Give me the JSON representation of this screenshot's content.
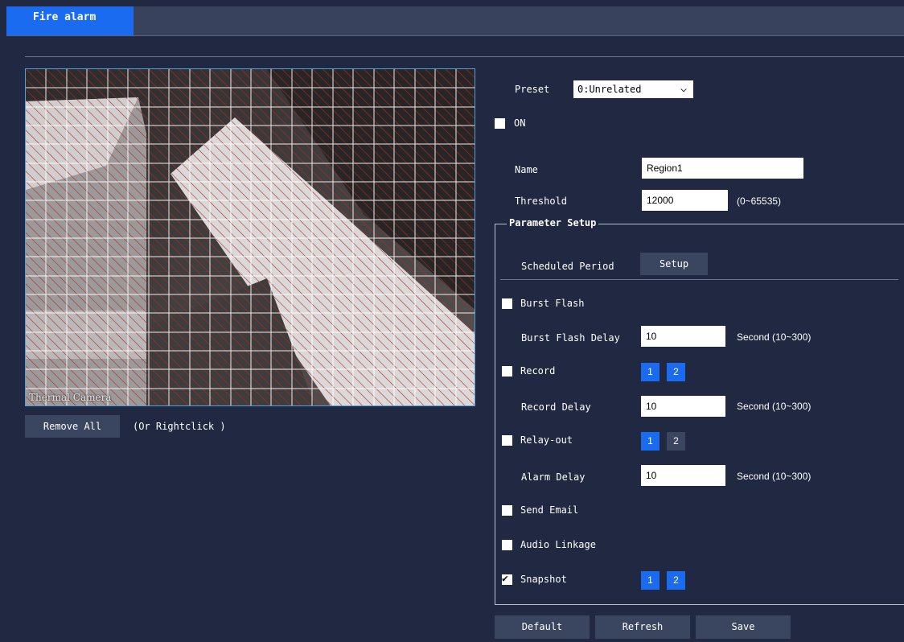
{
  "tabs": {
    "active_label": "Fire alarm"
  },
  "video": {
    "camera_label": "Thermal Camera"
  },
  "region_controls": {
    "remove_all_label": "Remove All",
    "hint": "(Or Rightclick )"
  },
  "preset": {
    "label": "Preset",
    "value": "0:Unrelated"
  },
  "enable": {
    "label": "ON",
    "checked": false
  },
  "name": {
    "label": "Name",
    "value": "Region1"
  },
  "threshold": {
    "label": "Threshold",
    "value": "12000",
    "range": "(0~65535)"
  },
  "parameter_setup": {
    "legend": "Parameter Setup",
    "scheduled_period_label": "Scheduled Period",
    "setup_button": "Setup",
    "burst_flash": {
      "label": "Burst Flash",
      "checked": false
    },
    "burst_flash_delay": {
      "label": "Burst Flash Delay",
      "value": "10",
      "unit": "Second (10~300)"
    },
    "record": {
      "label": "Record",
      "checked": false,
      "channels": [
        "1",
        "2"
      ],
      "selected": [
        true,
        true
      ]
    },
    "record_delay": {
      "label": "Record Delay",
      "value": "10",
      "unit": "Second (10~300)"
    },
    "relay_out": {
      "label": "Relay-out",
      "checked": false,
      "channels": [
        "1",
        "2"
      ],
      "selected": [
        true,
        false
      ]
    },
    "alarm_delay": {
      "label": "Alarm Delay",
      "value": "10",
      "unit": "Second (10~300)"
    },
    "send_email": {
      "label": "Send Email",
      "checked": false
    },
    "audio_linkage": {
      "label": "Audio Linkage",
      "checked": false
    },
    "snapshot": {
      "label": "Snapshot",
      "checked": true,
      "channels": [
        "1",
        "2"
      ],
      "selected": [
        true,
        true
      ]
    }
  },
  "footer": {
    "default_label": "Default",
    "refresh_label": "Refresh",
    "save_label": "Save"
  },
  "colors": {
    "accent": "#1a6bf0",
    "background": "#202842",
    "button": "#3a4560",
    "grid": "#ffffff",
    "hatch": "#c82020"
  }
}
